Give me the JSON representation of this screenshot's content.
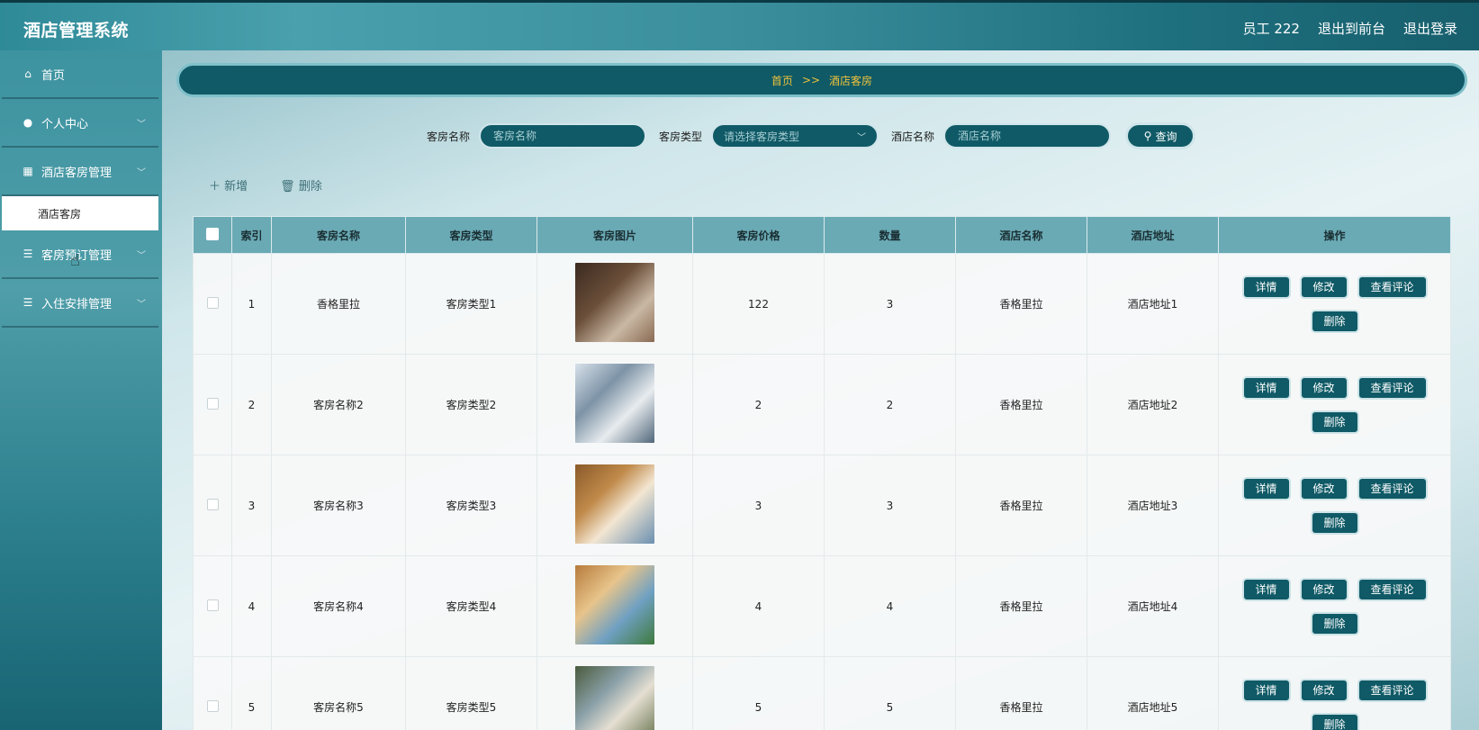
{
  "header": {
    "title": "酒店管理系统",
    "user": "员工 222",
    "front_link": "退出到前台",
    "logout": "退出登录"
  },
  "sidebar": {
    "items": [
      {
        "label": "首页",
        "icon": "home-icon"
      },
      {
        "label": "个人中心",
        "icon": "user-icon"
      },
      {
        "label": "酒店客房管理",
        "icon": "grid-icon"
      },
      {
        "label": "客房预订管理",
        "icon": "list-icon"
      },
      {
        "label": "入住安排管理",
        "icon": "list-icon"
      }
    ],
    "submenu": {
      "label": "酒店客房"
    }
  },
  "breadcrumb": {
    "home": "首页",
    "sep": ">>",
    "current": "酒店客房"
  },
  "search": {
    "room_name_label": "客房名称",
    "room_name_placeholder": "客房名称",
    "room_type_label": "客房类型",
    "room_type_placeholder": "请选择客房类型",
    "hotel_name_label": "酒店名称",
    "hotel_name_placeholder": "酒店名称",
    "query_label": "查询"
  },
  "actions": {
    "add": "新增",
    "delete": "删除"
  },
  "table": {
    "headers": [
      "索引",
      "客房名称",
      "客房类型",
      "客房图片",
      "客房价格",
      "数量",
      "酒店名称",
      "酒店地址",
      "操作"
    ],
    "rows": [
      {
        "index": "1",
        "name": "香格里拉",
        "type": "客房类型1",
        "price": "122",
        "qty": "3",
        "hotel": "香格里拉",
        "address": "酒店地址1"
      },
      {
        "index": "2",
        "name": "客房名称2",
        "type": "客房类型2",
        "price": "2",
        "qty": "2",
        "hotel": "香格里拉",
        "address": "酒店地址2"
      },
      {
        "index": "3",
        "name": "客房名称3",
        "type": "客房类型3",
        "price": "3",
        "qty": "3",
        "hotel": "香格里拉",
        "address": "酒店地址3"
      },
      {
        "index": "4",
        "name": "客房名称4",
        "type": "客房类型4",
        "price": "4",
        "qty": "4",
        "hotel": "香格里拉",
        "address": "酒店地址4"
      },
      {
        "index": "5",
        "name": "客房名称5",
        "type": "客房类型5",
        "price": "5",
        "qty": "5",
        "hotel": "香格里拉",
        "address": "酒店地址5"
      }
    ],
    "ops": {
      "detail": "详情",
      "edit": "修改",
      "comments": "查看评论",
      "delete": "删除"
    }
  }
}
